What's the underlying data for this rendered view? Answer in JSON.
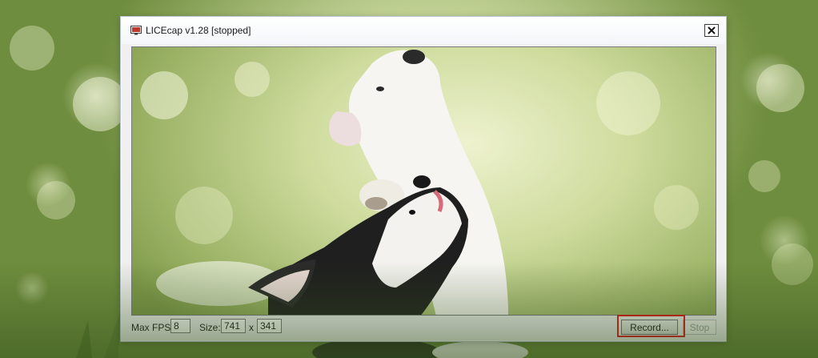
{
  "window": {
    "title": "LICEcap v1.28 [stopped]",
    "close_symbol": "✕"
  },
  "controls": {
    "max_fps_label": "Max FPS:",
    "max_fps_value": "8",
    "size_label": "Size:",
    "width_value": "741",
    "size_separator": "x",
    "height_value": "341",
    "record_label": "Record...",
    "stop_label": "Stop"
  },
  "icons": {
    "title_icon": "monitor-capture-icon",
    "close_icon": "close-icon"
  },
  "colors": {
    "highlight": "#e0151b"
  }
}
